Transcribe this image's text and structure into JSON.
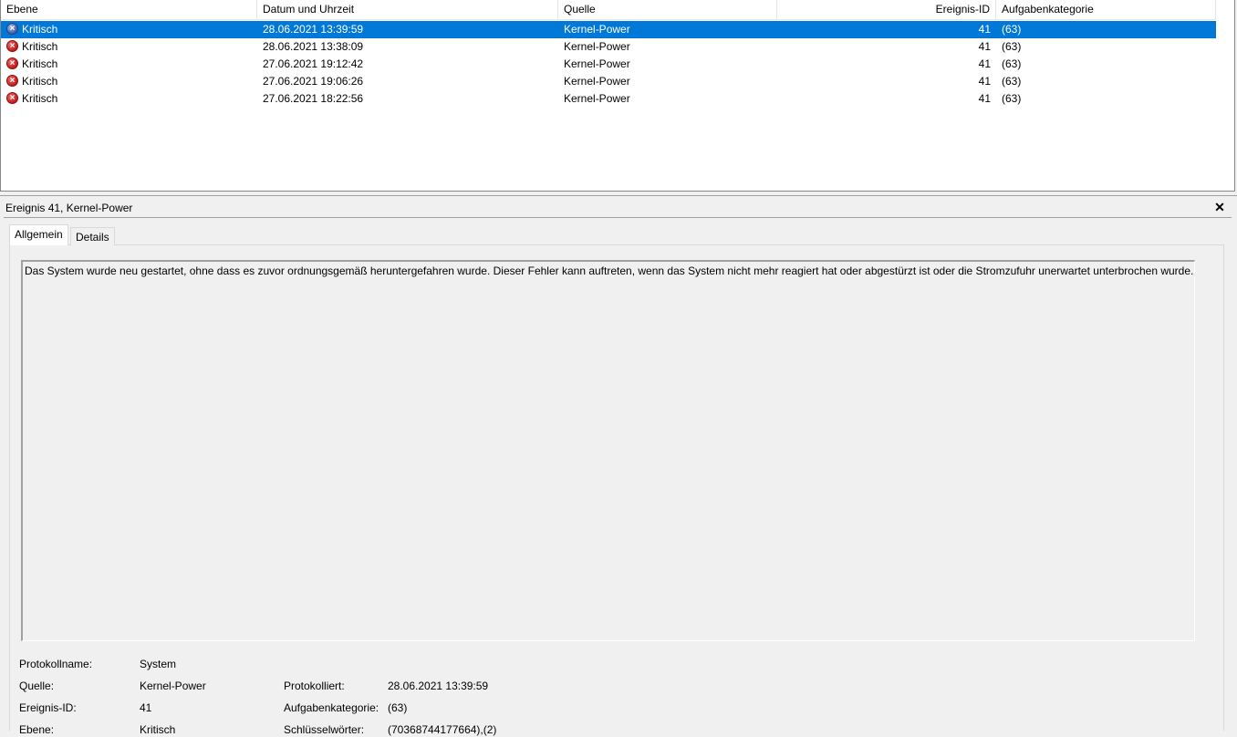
{
  "event_list": {
    "columns": {
      "level": "Ebene",
      "datetime": "Datum und Uhrzeit",
      "source": "Quelle",
      "event_id": "Ereignis-ID",
      "task_category": "Aufgabenkategorie"
    },
    "rows": [
      {
        "level": "Kritisch",
        "datetime": "28.06.2021 13:39:59",
        "source": "Kernel-Power",
        "event_id": "41",
        "task_category": "(63)",
        "selected": true
      },
      {
        "level": "Kritisch",
        "datetime": "28.06.2021 13:38:09",
        "source": "Kernel-Power",
        "event_id": "41",
        "task_category": "(63)",
        "selected": false
      },
      {
        "level": "Kritisch",
        "datetime": "27.06.2021 19:12:42",
        "source": "Kernel-Power",
        "event_id": "41",
        "task_category": "(63)",
        "selected": false
      },
      {
        "level": "Kritisch",
        "datetime": "27.06.2021 19:06:26",
        "source": "Kernel-Power",
        "event_id": "41",
        "task_category": "(63)",
        "selected": false
      },
      {
        "level": "Kritisch",
        "datetime": "27.06.2021 18:22:56",
        "source": "Kernel-Power",
        "event_id": "41",
        "task_category": "(63)",
        "selected": false
      }
    ],
    "icon": "critical-error-icon"
  },
  "detail": {
    "title": "Ereignis 41, Kernel-Power",
    "close_glyph": "✕",
    "tabs": [
      "Allgemein",
      "Details"
    ],
    "active_tab": "Allgemein",
    "description": "Das System wurde neu gestartet, ohne dass es zuvor ordnungsgemäß heruntergefahren wurde. Dieser Fehler kann auftreten, wenn das System nicht mehr reagiert hat oder abgestürzt ist oder die Stromzufuhr unerwartet unterbrochen wurde.",
    "properties": {
      "log_name_label": "Protokollname:",
      "log_name_value": "System",
      "source_label": "Quelle:",
      "source_value": "Kernel-Power",
      "logged_label": "Protokolliert:",
      "logged_value": "28.06.2021 13:39:59",
      "event_id_label": "Ereignis-ID:",
      "event_id_value": "41",
      "task_category_label": "Aufgabenkategorie:",
      "task_category_value": "(63)",
      "level_label": "Ebene:",
      "level_value": "Kritisch",
      "keywords_label": "Schlüsselwörter:",
      "keywords_value": "(70368744177664),(2)"
    }
  },
  "colors": {
    "selection": "#0078d7",
    "critical": "#c21a1a"
  }
}
